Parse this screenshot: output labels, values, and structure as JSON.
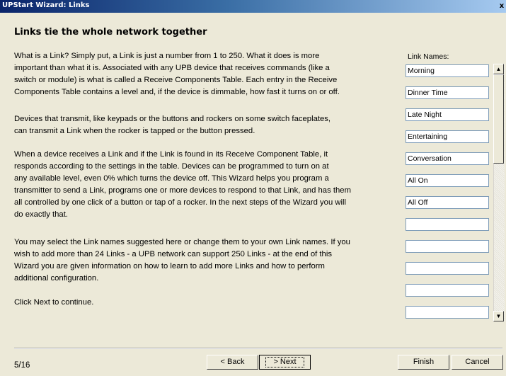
{
  "window": {
    "title": "UPStart Wizard: Links",
    "close_glyph": "x"
  },
  "heading": "Links tie the whole network together",
  "paragraphs": [
    "What is a Link? Simply put, a Link is just a number from 1 to 250. What it does is more\nimportant than what it is. Associated with any UPB device that receives commands (like a\nswitch or module) is what is called a Receive Components Table. Each entry in the Receive\nComponents Table contains a level and, if the device is dimmable, how fast it turns on or off.",
    "Devices that transmit, like keypads or the buttons and rockers on some switch faceplates,\ncan transmit a Link when the rocker is tapped or the button pressed.",
    "When a device receives a Link and if the Link is found in its Receive Component Table, it\nresponds according to the settings in the table. Devices can be programmed to turn on at\nany available level, even 0% which turns the device off. This Wizard helps you program a\ntransmitter to send a Link, programs one or more devices to respond to that Link, and has them\nall controlled by one click of a button or tap of a rocker. In the next steps of the Wizard you will\ndo exactly that.",
    "You may select the Link names suggested here or change them to your own Link names. If you\nwish to add more than 24 Links - a UPB network can support 250 Links - at the end of this\nWizard you are given information on how to learn to add more Links and how to perform\nadditional configuration.",
    "Click Next to continue."
  ],
  "link_names": {
    "label": "Link Names:",
    "values": [
      "Morning",
      "Dinner Time",
      "Late Night",
      "Entertaining",
      "Conversation",
      "All On",
      "All Off",
      "",
      "",
      "",
      "",
      ""
    ]
  },
  "scrollbar": {
    "up_glyph": "▲",
    "down_glyph": "▼"
  },
  "footer": {
    "step": "5/16",
    "back": "< Back",
    "next": "> Next",
    "finish": "Finish",
    "cancel": "Cancel"
  }
}
